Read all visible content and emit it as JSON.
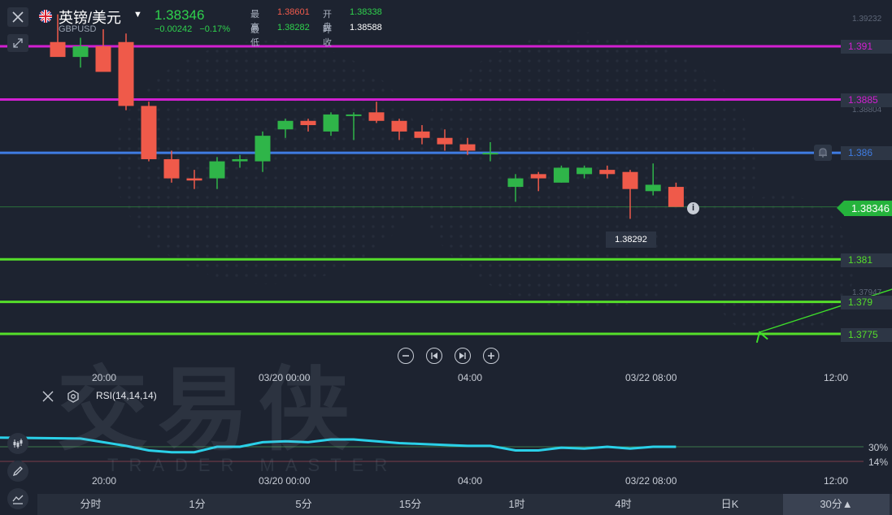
{
  "header": {
    "pair_name": "英镑/美元",
    "pair_code": "GBPUSD",
    "price": "1.38346",
    "change": "−0.00242",
    "change_pct": "−0.17%",
    "high_label": "最高",
    "high": "1.38601",
    "open_label": "开盘",
    "open": "1.38338",
    "low_label": "最低",
    "low": "1.38282",
    "prev_label": "昨收",
    "prev": "1.38588"
  },
  "levels": [
    {
      "label": "1.391",
      "color": "#d21fd1"
    },
    {
      "label": "1.3885",
      "color": "#d21fd1"
    },
    {
      "label": "1.386",
      "color": "#3f7ce2"
    },
    {
      "label": "1.381",
      "color": "#55de2a"
    },
    {
      "label": "1.379",
      "color": "#55de2a"
    },
    {
      "label": "1.3775",
      "color": "#55de2a"
    }
  ],
  "current_price_tag": "1.38346",
  "tooltip_price": "1.38292",
  "faint_axis_labels": [
    "1.39232",
    "1.38804",
    "1.37947"
  ],
  "time_labels": [
    "20:00",
    "03/20 00:00",
    "04:00",
    "03/22 08:00",
    "12:00"
  ],
  "watermark": {
    "main": "交易侠",
    "sub": "TRADER MASTER"
  },
  "rsi": {
    "label": "RSI(14,14,14)",
    "levels": [
      "30%",
      "14%"
    ],
    "color": "#2ad0e8"
  },
  "timeframes": [
    "分时",
    "1分",
    "5分",
    "15分",
    "1时",
    "4时",
    "日K",
    "30分▲"
  ],
  "active_timeframe": "30分▲",
  "colors": {
    "up": "#2fb549",
    "down": "#ef5a4a",
    "background": "#1d2330"
  },
  "chart_data": {
    "type": "candlestick",
    "symbol": "GBPUSD",
    "series": [
      {
        "name": "candles",
        "ohlc": [
          [
            1.3912,
            1.3925,
            1.3908,
            1.3905
          ],
          [
            1.3905,
            1.3914,
            1.39,
            1.391
          ],
          [
            1.391,
            1.3918,
            1.3906,
            1.3898
          ],
          [
            1.3912,
            1.3916,
            1.388,
            1.3882
          ],
          [
            1.3882,
            1.3884,
            1.3856,
            1.3857
          ],
          [
            1.3857,
            1.3861,
            1.3846,
            1.3848
          ],
          [
            1.3848,
            1.3852,
            1.3843,
            1.3847
          ],
          [
            1.3848,
            1.3858,
            1.3843,
            1.3856
          ],
          [
            1.3856,
            1.3859,
            1.3853,
            1.3857
          ],
          [
            1.3856,
            1.387,
            1.3851,
            1.3868
          ],
          [
            1.3871,
            1.3876,
            1.3867,
            1.3875
          ],
          [
            1.3875,
            1.3876,
            1.387,
            1.3873
          ],
          [
            1.387,
            1.3879,
            1.3868,
            1.3878
          ],
          [
            1.3878,
            1.3879,
            1.3866,
            1.3878
          ],
          [
            1.3879,
            1.3884,
            1.3874,
            1.3875
          ],
          [
            1.3875,
            1.3876,
            1.3866,
            1.387
          ],
          [
            1.387,
            1.3873,
            1.3864,
            1.3867
          ],
          [
            1.3867,
            1.3871,
            1.3861,
            1.3864
          ],
          [
            1.3864,
            1.3867,
            1.3859,
            1.3861
          ],
          [
            1.386,
            1.3865,
            1.3856,
            1.386
          ],
          [
            1.3844,
            1.385,
            1.3837,
            1.3848
          ],
          [
            1.385,
            1.3851,
            1.3842,
            1.3848
          ],
          [
            1.3846,
            1.3854,
            1.3846,
            1.3853
          ],
          [
            1.385,
            1.3854,
            1.3848,
            1.3853
          ],
          [
            1.3852,
            1.3854,
            1.3848,
            1.385
          ],
          [
            1.3851,
            1.3852,
            1.3829,
            1.3843
          ],
          [
            1.3842,
            1.3855,
            1.384,
            1.3845
          ],
          [
            1.3844,
            1.3846,
            1.3843,
            1.38346
          ]
        ]
      },
      {
        "name": "RSI",
        "values": [
          40,
          39,
          35,
          31,
          26,
          24,
          24,
          30,
          30,
          35,
          36,
          35,
          38,
          38,
          36,
          34,
          33,
          32,
          31,
          31,
          26,
          26,
          29,
          28,
          30,
          28,
          30,
          30
        ]
      }
    ],
    "horizontal_levels": [
      1.391,
      1.3885,
      1.386,
      1.381,
      1.379,
      1.3775
    ],
    "projected_path": [
      [
        1.38346,
        1.3775
      ]
    ],
    "ylim": [
      1.3772,
      1.3935
    ],
    "x_tick_labels": [
      "20:00",
      "03/20 00:00",
      "04:00",
      "03/22 08:00",
      "12:00"
    ],
    "legend": "none",
    "grid": false
  }
}
